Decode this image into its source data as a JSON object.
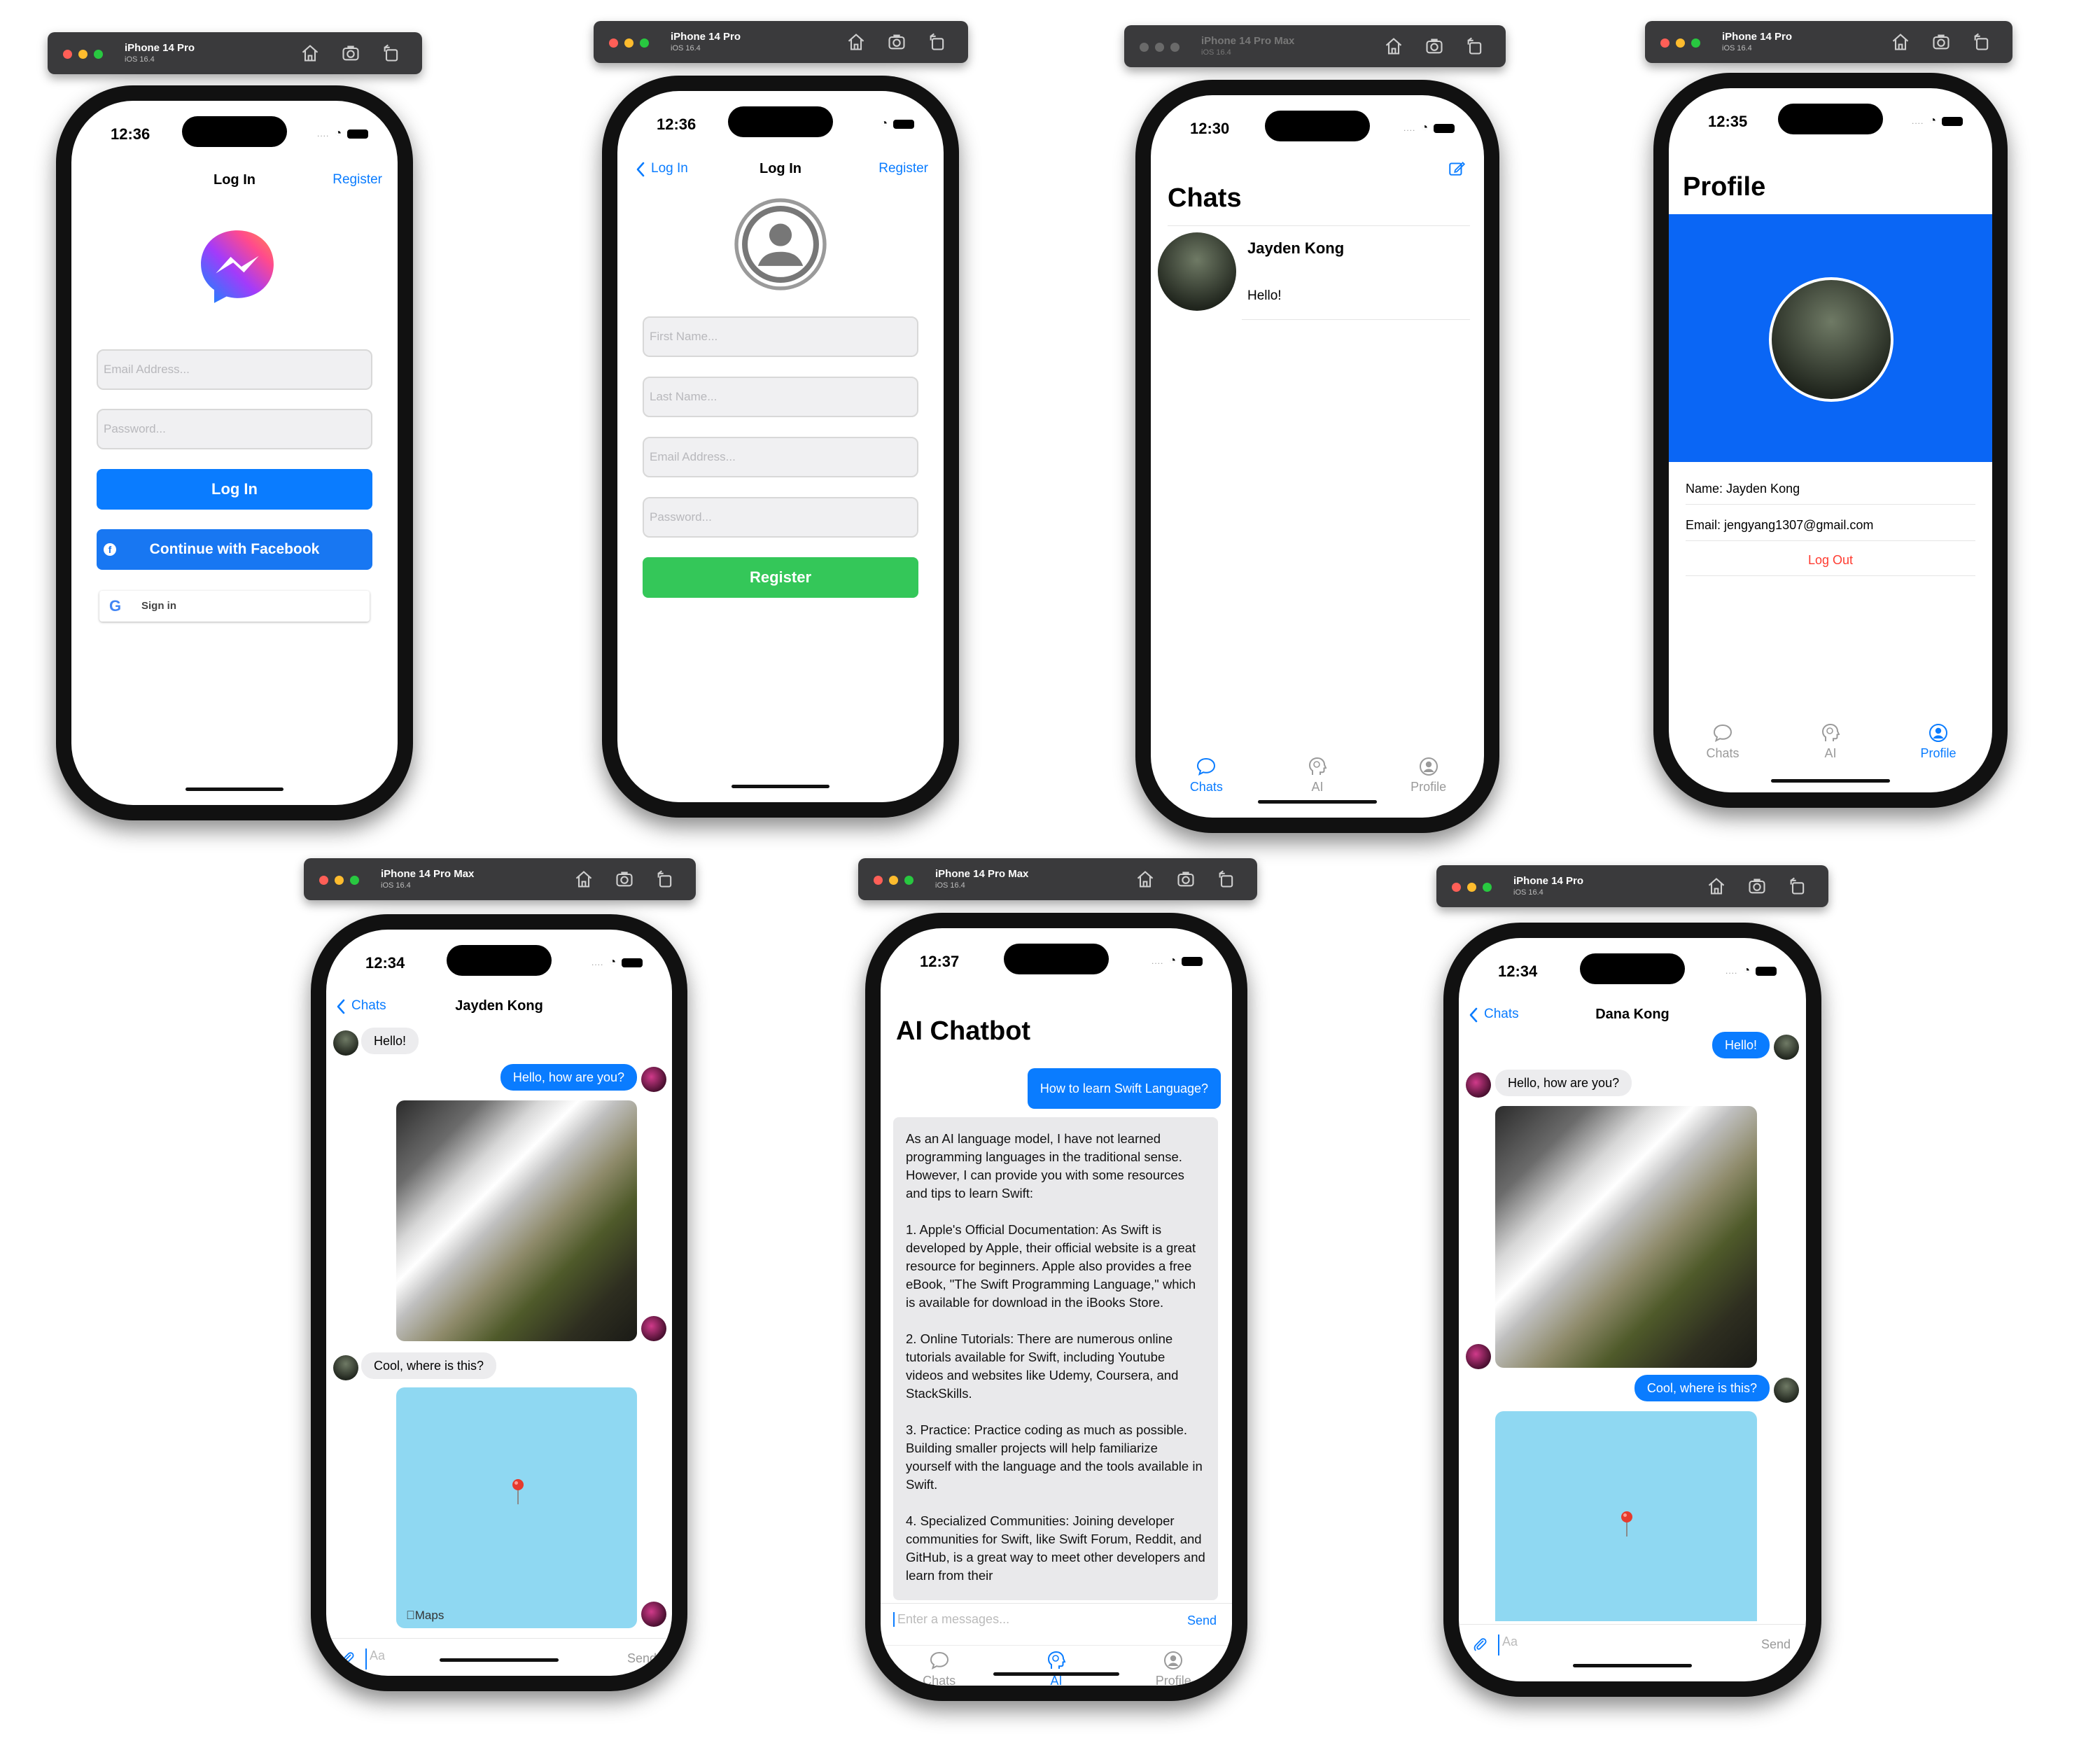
{
  "colors": {
    "ios_blue": "#0a7cff",
    "facebook_blue": "#1877f2",
    "register_green": "#34c759",
    "profile_header_blue": "#0a66f5",
    "logout_red": "#ff3b30",
    "map_blue": "#8fd8f2",
    "simulator_bar": "#3a3a3c"
  },
  "simulators": [
    {
      "device": "iPhone 14 Pro",
      "os": "iOS 16.4",
      "time": "12:36",
      "screen": "login",
      "nav_title": "Log In",
      "nav_right": "Register",
      "logo_icon": "messenger-logo",
      "email_placeholder": "Email Address...",
      "password_placeholder": "Password...",
      "login_button": "Log In",
      "facebook_button": "Continue with Facebook",
      "google_button": "Sign in"
    },
    {
      "device": "iPhone 14 Pro",
      "os": "iOS 16.4",
      "time": "12:36",
      "screen": "register",
      "nav_back": "Log In",
      "nav_title": "Log In",
      "nav_right": "Register",
      "avatar_icon": "person-circle-icon",
      "first_name_placeholder": "First Name...",
      "last_name_placeholder": "Last Name...",
      "email_placeholder": "Email Address...",
      "password_placeholder": "Password...",
      "register_button": "Register"
    },
    {
      "device": "iPhone 14 Pro Max",
      "os": "iOS 16.4",
      "time": "12:30",
      "screen": "chats",
      "title": "Chats",
      "compose_icon": "compose-icon",
      "conversation": {
        "name": "Jayden Kong",
        "last_message": "Hello!"
      },
      "tabs": [
        "Chats",
        "AI",
        "Profile"
      ],
      "active_tab": "Chats"
    },
    {
      "device": "iPhone 14 Pro",
      "os": "iOS 16.4",
      "time": "12:35",
      "screen": "profile",
      "title": "Profile",
      "name_row": "Name: Jayden Kong",
      "email_row": "Email: jengyang1307@gmail.com",
      "logout": "Log Out",
      "tabs": [
        "Chats",
        "AI",
        "Profile"
      ],
      "active_tab": "Profile"
    },
    {
      "device": "iPhone 14 Pro Max",
      "os": "iOS 16.4",
      "time": "12:34",
      "screen": "conversation",
      "nav_back": "Chats",
      "nav_title": "Jayden Kong",
      "messages": [
        {
          "side": "left",
          "text": "Hello!"
        },
        {
          "side": "right",
          "text": "Hello, how are you?"
        },
        {
          "side": "right",
          "type": "photo"
        },
        {
          "side": "left",
          "text": "Cool, where is this?"
        },
        {
          "side": "right",
          "type": "map",
          "map_label": "Maps"
        }
      ],
      "input_placeholder": "Aa",
      "send": "Send"
    },
    {
      "device": "iPhone 14 Pro Max",
      "os": "iOS 16.4",
      "time": "12:37",
      "screen": "ai_chatbot",
      "title": "AI Chatbot",
      "question": "How to learn Swift Language?",
      "answer": "As an AI language model, I have not learned programming languages in the traditional sense. However, I can provide you with some resources and tips to learn Swift:\n\n1. Apple's Official Documentation: As Swift is developed by Apple, their official website is a great resource for beginners. Apple also provides a free eBook, \"The Swift Programming Language,\" which is available for download in the iBooks Store.\n\n2. Online Tutorials: There are numerous online tutorials available for Swift, including Youtube videos and websites like Udemy, Coursera, and StackSkills.\n\n3. Practice: Practice coding as much as possible. Building smaller projects will help familiarize yourself with the language and the tools available in Swift.\n\n4. Specialized Communities: Joining developer communities for Swift, like Swift Forum, Reddit, and GitHub, is a great way to meet other developers and learn from their",
      "input_placeholder": "Enter a messages...",
      "send": "Send",
      "tabs": [
        "Chats",
        "AI",
        "Profile"
      ],
      "active_tab": "AI"
    },
    {
      "device": "iPhone 14 Pro",
      "os": "iOS 16.4",
      "time": "12:34",
      "screen": "conversation",
      "nav_back": "Chats",
      "nav_title": "Dana Kong",
      "messages": [
        {
          "side": "right",
          "text": "Hello!"
        },
        {
          "side": "left",
          "text": "Hello, how are you?"
        },
        {
          "side": "left",
          "type": "photo"
        },
        {
          "side": "right",
          "text": "Cool, where is this?"
        },
        {
          "side": "right",
          "type": "map"
        }
      ],
      "input_placeholder": "Aa",
      "send": "Send"
    }
  ]
}
